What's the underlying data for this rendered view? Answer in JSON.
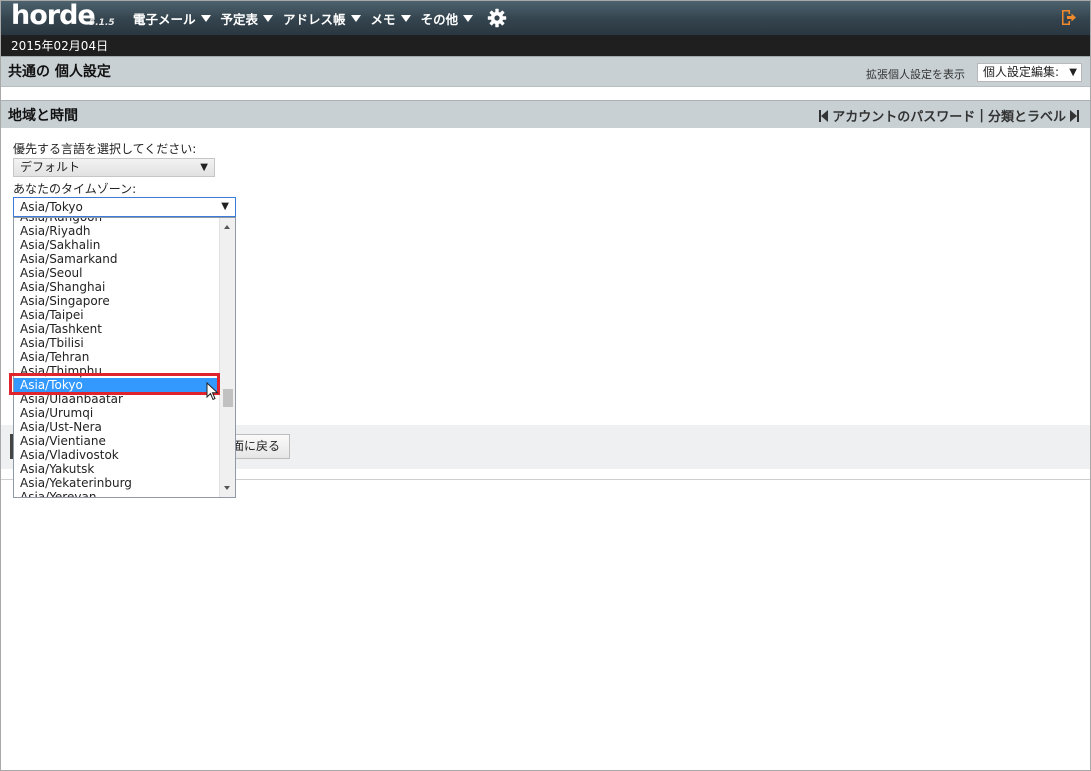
{
  "app": {
    "logo": "horde",
    "version": "5.1.5",
    "menu": [
      {
        "label": "電子メール"
      },
      {
        "label": "予定表"
      },
      {
        "label": "アドレス帳"
      },
      {
        "label": "メモ"
      },
      {
        "label": "その他"
      }
    ],
    "date": "2015年02月04日"
  },
  "header": {
    "title": "共通の 個人設定",
    "advanced_link": "拡張個人設定を表示",
    "pref_select": "個人設定編集:"
  },
  "section": {
    "title": "地域と時間",
    "nav_prev": "アカウントのパスワード",
    "nav_separator": "|",
    "nav_next": "分類とラベル"
  },
  "form": {
    "language_label": "優先する言語を選択してください:",
    "language_value": "デフォルト",
    "timezone_label": "あなたのタイムゾーン:",
    "timezone_value": "Asia/Tokyo",
    "back_button": "面に戻る",
    "timezone_options": [
      "Asia/Rangoon",
      "Asia/Riyadh",
      "Asia/Sakhalin",
      "Asia/Samarkand",
      "Asia/Seoul",
      "Asia/Shanghai",
      "Asia/Singapore",
      "Asia/Taipei",
      "Asia/Tashkent",
      "Asia/Tbilisi",
      "Asia/Tehran",
      "Asia/Thimphu",
      "Asia/Tokyo",
      "Asia/Ulaanbaatar",
      "Asia/Urumqi",
      "Asia/Ust-Nera",
      "Asia/Vientiane",
      "Asia/Vladivostok",
      "Asia/Yakutsk",
      "Asia/Yekaterinburg",
      "Asia/Yerevan"
    ],
    "selected_index": 12
  },
  "icons": {
    "menu_caret": "caret-down-icon",
    "settings": "gear-icon",
    "logout": "logout-icon",
    "nav_first": "first-page-icon",
    "nav_last": "last-page-icon"
  },
  "colors": {
    "topbar": "#34444e",
    "logout_icon": "#f08a2c",
    "selected_row": "#3399ff",
    "highlight_border": "#e0242e"
  }
}
